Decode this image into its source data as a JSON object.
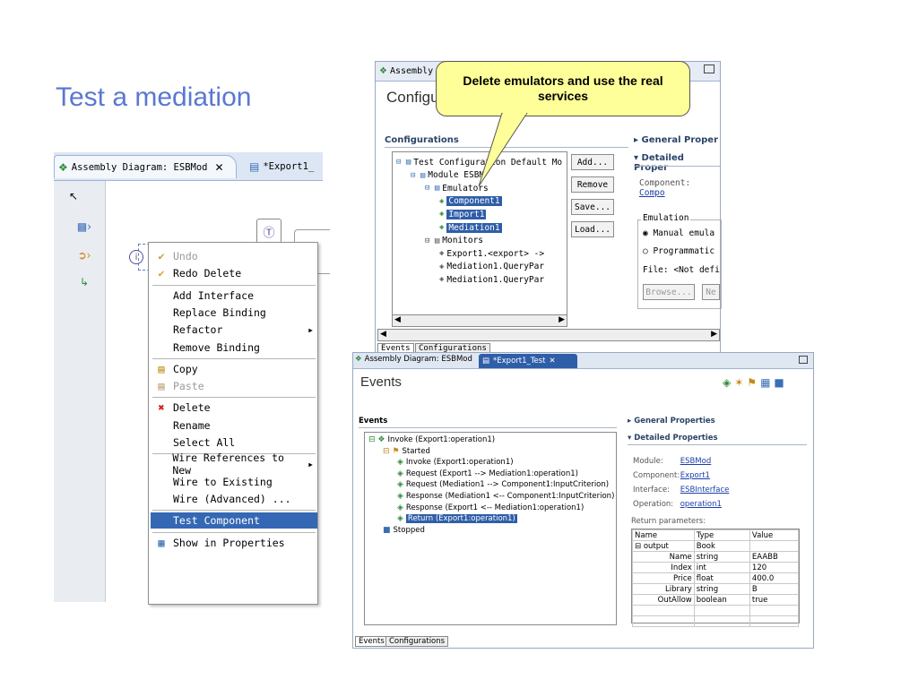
{
  "slide": {
    "title": "Test a mediation"
  },
  "callout": {
    "text": "Delete emulators and use the real services"
  },
  "left": {
    "tab_active": "Assembly Diagram: ESBMod",
    "tab_inactive": "*Export1_",
    "menu": [
      {
        "label": "Undo",
        "icon": "undo-icon",
        "disabled": true
      },
      {
        "label": "Redo Delete",
        "icon": "redo-icon",
        "disabled": false
      },
      {
        "sep": true
      },
      {
        "label": "Add Interface"
      },
      {
        "label": "Replace Binding"
      },
      {
        "label": "Refactor",
        "submenu": true
      },
      {
        "label": "Remove Binding"
      },
      {
        "sep": true
      },
      {
        "label": "Copy",
        "icon": "copy-icon"
      },
      {
        "label": "Paste",
        "icon": "paste-icon",
        "disabled": true
      },
      {
        "sep": true
      },
      {
        "label": "Delete",
        "icon": "delete-icon"
      },
      {
        "label": "Rename"
      },
      {
        "label": "Select All"
      },
      {
        "sep": true
      },
      {
        "label": "Wire References to New",
        "submenu": true
      },
      {
        "label": "Wire to Existing"
      },
      {
        "label": "Wire (Advanced) ..."
      },
      {
        "sep": true
      },
      {
        "label": "Test Component",
        "selected": true
      },
      {
        "sep": true
      },
      {
        "label": "Show in Properties",
        "icon": "properties-icon"
      }
    ]
  },
  "topwin": {
    "tab": "Assembly",
    "heading": "Configu",
    "configurations_label": "Configurations",
    "tree": [
      {
        "label": "Test Configuration Default Mo",
        "indent": 0
      },
      {
        "label": "Module ESBM",
        "indent": 1
      },
      {
        "label": "Emulators",
        "indent": 2
      },
      {
        "label": "Component1",
        "indent": 3,
        "hl": true
      },
      {
        "label": "Import1",
        "indent": 3,
        "hl": true
      },
      {
        "label": "Mediation1",
        "indent": 3,
        "hl": true
      },
      {
        "label": "Monitors",
        "indent": 2
      },
      {
        "label": "Export1.<export> ->",
        "indent": 3
      },
      {
        "label": "Mediation1.QueryPar",
        "indent": 3
      },
      {
        "label": "Mediation1.QueryPar",
        "indent": 3
      }
    ],
    "buttons": [
      "Add...",
      "Remove",
      "Save...",
      "Load..."
    ],
    "general": "General Proper",
    "detailed": "Detailed Proper",
    "component_label": "Component:",
    "component_value": "Compo",
    "emulation_label": "Emulation",
    "manual": "Manual emula",
    "programmatic": "Programmatic",
    "file_label": "File:",
    "file_value": "<Not defi",
    "browse": "Browse...",
    "ne": "Ne",
    "bottom_tabs": [
      "Events",
      "Configurations"
    ]
  },
  "botwin": {
    "tab1": "Assembly Diagram: ESBMod",
    "tab2": "*Export1_Test",
    "heading": "Events",
    "events_label": "Events",
    "tree": [
      {
        "label": "Invoke (Export1:operation1)",
        "indent": 0
      },
      {
        "label": "Started",
        "indent": 1
      },
      {
        "label": "Invoke (Export1:operation1)",
        "indent": 2
      },
      {
        "label": "Request (Export1 --> Mediation1:operation1)",
        "indent": 2
      },
      {
        "label": "Request (Mediation1 --> Component1:InputCriterion)",
        "indent": 2
      },
      {
        "label": "Response (Mediation1 <-- Component1:InputCriterion)",
        "indent": 2
      },
      {
        "label": "Response (Export1 <-- Mediation1:operation1)",
        "indent": 2
      },
      {
        "label": "Return (Export1:operation1)",
        "indent": 2,
        "sel": true
      },
      {
        "label": "Stopped",
        "indent": 1
      }
    ],
    "general": "General Properties",
    "detailed": "Detailed Properties",
    "module_label": "Module:",
    "module_value": "ESBMod",
    "component_label": "Component:",
    "component_value": "Export1",
    "interface_label": "Interface:",
    "interface_value": "ESBInterface",
    "operation_label": "Operation:",
    "operation_value": "operation1",
    "return_params": "Return parameters:",
    "table_headers": [
      "Name",
      "Type",
      "Value"
    ],
    "table_rows": [
      [
        "output",
        "Book",
        ""
      ],
      [
        "Name",
        "string",
        "EAABB"
      ],
      [
        "Index",
        "int",
        "120"
      ],
      [
        "Price",
        "float",
        "400.0"
      ],
      [
        "Library",
        "string",
        "B"
      ],
      [
        "OutAllow",
        "boolean",
        "true"
      ]
    ],
    "bottom_tabs": [
      "Events",
      "Configurations"
    ]
  }
}
